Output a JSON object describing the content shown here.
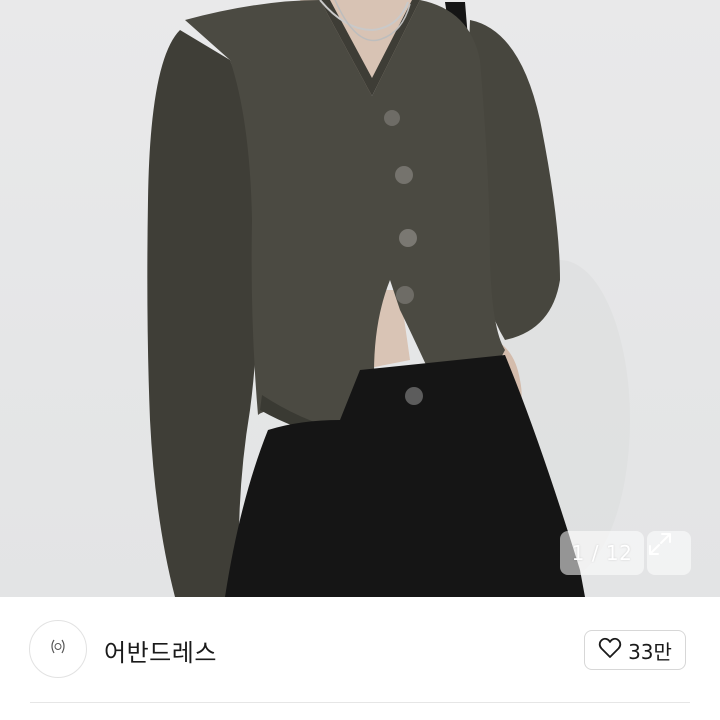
{
  "gallery": {
    "current": "1",
    "total": "12",
    "counter_text": "1 / 12",
    "expand_icon": "expand-arrows-icon"
  },
  "seller": {
    "name": "어반드레스",
    "avatar_icon": "laurel-wreath-logo-icon"
  },
  "like": {
    "icon": "heart-outline-icon",
    "count": "33만"
  },
  "colors": {
    "background": "#e6e7e8",
    "cardigan": "#4b4a42",
    "skirt": "#141414",
    "text": "#1a1a1a",
    "border": "#d7d7d7"
  }
}
